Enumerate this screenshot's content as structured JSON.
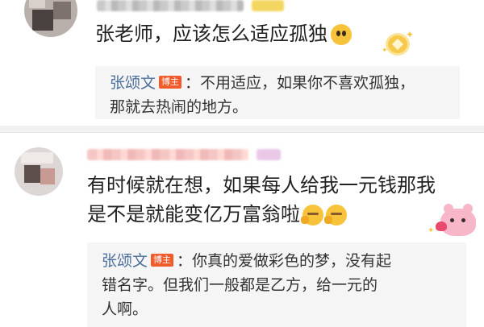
{
  "comments": [
    {
      "text": "张老师，应该怎么适应孤独",
      "emojis": [
        "sad-face-emoji"
      ],
      "decorations": [
        "gold-coin-badge"
      ],
      "reply": {
        "author": "张颂文",
        "badge": "博主",
        "text_lines": [
          "：不用适应，如果你不喜欢孤独，",
          "那就去热闹的地方。"
        ]
      }
    },
    {
      "text_lines": [
        "有时候就在想，如果每人给我一元钱那我",
        "是不是就能变亿万富翁啦"
      ],
      "emojis": [
        "thinking-face-emoji",
        "thinking-face-emoji"
      ],
      "decorations": [
        "pink-bear-sticker"
      ],
      "reply": {
        "author": "张颂文",
        "badge": "博主",
        "text_lines": [
          "：你真的爱做彩色的梦，没有起",
          "错名字。但我们一般都是乙方，给一元的",
          "人啊。"
        ]
      }
    }
  ],
  "colors": {
    "author": "#4c6f9b",
    "badge_bg": "#f15a2a",
    "reply_bg": "#f5f5f5",
    "divider_bg": "#f2f2f2"
  }
}
